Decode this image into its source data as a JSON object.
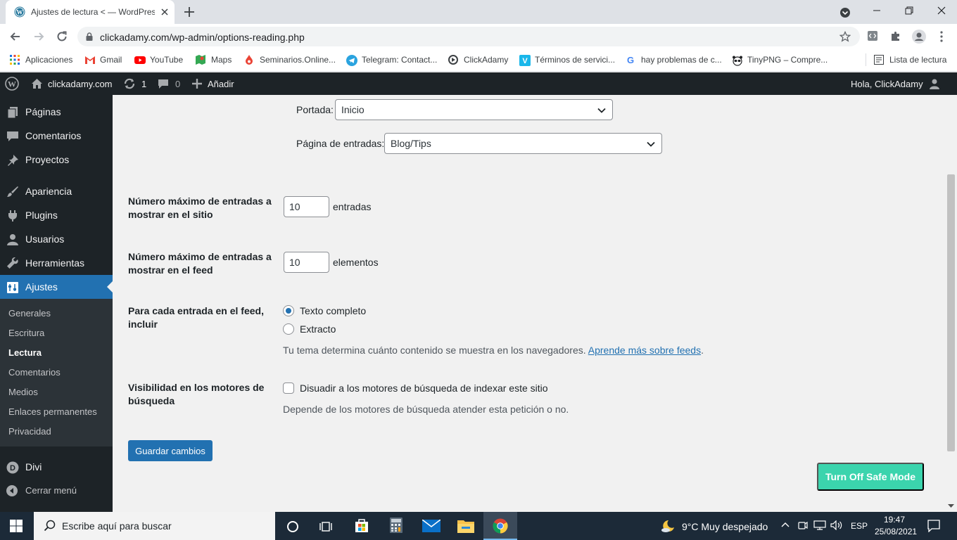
{
  "browser": {
    "tab_title": "Ajustes de lectura < — WordPress",
    "url": "clickadamy.com/wp-admin/options-reading.php",
    "bookmarks": [
      {
        "label": "Aplicaciones",
        "icon": "apps-grid-icon"
      },
      {
        "label": "Gmail",
        "icon": "gmail-icon"
      },
      {
        "label": "YouTube",
        "icon": "youtube-icon"
      },
      {
        "label": "Maps",
        "icon": "maps-icon"
      },
      {
        "label": "Seminarios.Online...",
        "icon": "seminarios-icon"
      },
      {
        "label": "Telegram: Contact...",
        "icon": "telegram-icon"
      },
      {
        "label": "ClickAdamy",
        "icon": "clickadamy-icon"
      },
      {
        "label": "Términos de servici...",
        "icon": "vimeo-icon"
      },
      {
        "label": "hay problemas de c...",
        "icon": "google-icon"
      },
      {
        "label": "TinyPNG – Compre...",
        "icon": "tinypng-icon"
      }
    ],
    "reading_list": "Lista de lectura"
  },
  "adminbar": {
    "site": "clickadamy.com",
    "updates": "1",
    "comments": "0",
    "add": "Añadir",
    "greeting": "Hola, ClickAdamy"
  },
  "sidebar": {
    "items": [
      {
        "label": "Páginas",
        "icon": "pages-icon"
      },
      {
        "label": "Comentarios",
        "icon": "comments-icon"
      },
      {
        "label": "Proyectos",
        "icon": "pin-icon"
      },
      {
        "label": "Apariencia",
        "icon": "brush-icon"
      },
      {
        "label": "Plugins",
        "icon": "plugin-icon"
      },
      {
        "label": "Usuarios",
        "icon": "users-icon"
      },
      {
        "label": "Herramientas",
        "icon": "wrench-icon"
      },
      {
        "label": "Ajustes",
        "icon": "settings-icon"
      }
    ],
    "submenu": [
      "Generales",
      "Escritura",
      "Lectura",
      "Comentarios",
      "Medios",
      "Enlaces permanentes",
      "Privacidad"
    ],
    "divi": "Divi",
    "collapse": "Cerrar menú"
  },
  "form": {
    "portada_label": "Portada:",
    "portada_value": "Inicio",
    "entradas_label": "Página de entradas:",
    "entradas_value": "Blog/Tips",
    "posts_per_page_label": "Número máximo de entradas a mostrar en el sitio",
    "posts_per_page_value": "10",
    "posts_per_page_unit": "entradas",
    "feed_items_label": "Número máximo de entradas a mostrar en el feed",
    "feed_items_value": "10",
    "feed_items_unit": "elementos",
    "feed_content_label": "Para cada entrada en el feed, incluir",
    "feed_full": "Texto completo",
    "feed_excerpt": "Extracto",
    "feed_desc": "Tu tema determina cuánto contenido se muestra en los navegadores.",
    "feed_link": "Aprende más sobre feeds",
    "visibility_label": "Visibilidad en los motores de búsqueda",
    "visibility_check": "Disuadir a los motores de búsqueda de indexar este sitio",
    "visibility_desc": "Depende de los motores de búsqueda atender esta petición o no.",
    "save": "Guardar cambios",
    "safe_mode": "Turn Off Safe Mode"
  },
  "taskbar": {
    "search_placeholder": "Escribe aquí para buscar",
    "weather": "9°C  Muy despejado",
    "lang": "ESP",
    "time": "19:47",
    "date": "25/08/2021"
  },
  "colors": {
    "wp_blue": "#2271b1",
    "admin_dark": "#1d2327",
    "safe_mode_green": "#3bd4ad"
  }
}
